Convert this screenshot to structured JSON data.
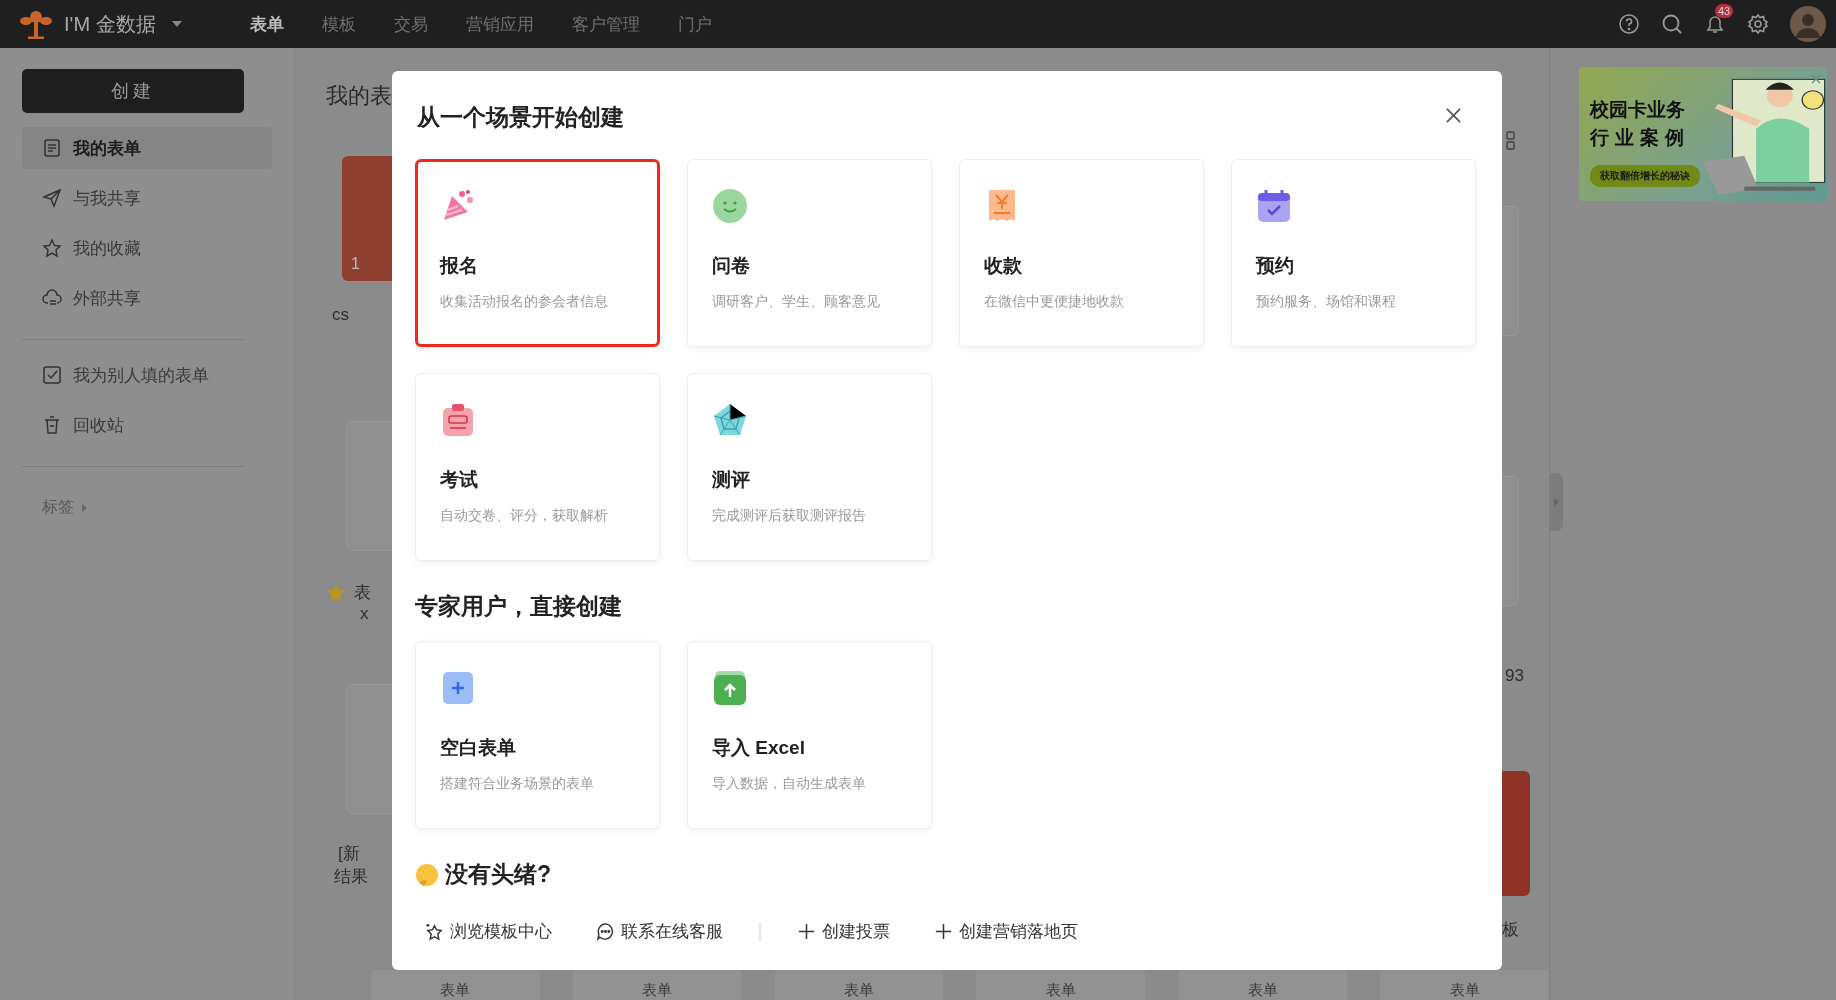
{
  "topbar": {
    "brand": "I'M 金数据",
    "nav": [
      {
        "label": "表单",
        "selected": true
      },
      {
        "label": "模板",
        "selected": false
      },
      {
        "label": "交易",
        "selected": false
      },
      {
        "label": "营销应用",
        "selected": false
      },
      {
        "label": "客户管理",
        "selected": false
      },
      {
        "label": "门户",
        "selected": false
      }
    ],
    "notification_count": "43"
  },
  "sidebar": {
    "create_button": "创建",
    "groups": [
      [
        {
          "kind": "doc",
          "label": "我的表单",
          "selected": true
        },
        {
          "kind": "send",
          "label": "与我共享",
          "selected": false
        },
        {
          "kind": "star",
          "label": "我的收藏",
          "selected": false
        },
        {
          "kind": "cloud",
          "label": "外部共享",
          "selected": false
        }
      ],
      [
        {
          "kind": "check",
          "label": "我为别人填的表单",
          "selected": false
        },
        {
          "kind": "trash",
          "label": "回收站",
          "selected": false
        }
      ]
    ],
    "tags_label": "标签"
  },
  "background": {
    "heading": "我的表",
    "folder_count": "1",
    "left_labels": [
      "cs",
      "表",
      "x",
      "[新",
      "结果"
    ],
    "right_labels": [
      "93",
      "板"
    ],
    "bottom_tabs": [
      "表单",
      "表单",
      "表单",
      "表单",
      "表单",
      "表单"
    ]
  },
  "banner": {
    "title_lines": [
      "校园卡业务",
      "行业案例"
    ],
    "button": "获取翻倍增长的秘诀"
  },
  "modal": {
    "title": "从一个场景开始创建",
    "scenario_cards": [
      {
        "kind": "signup",
        "title": "报名",
        "description": "收集活动报名的参会者信息",
        "selected": true
      },
      {
        "kind": "survey",
        "title": "问卷",
        "description": "调研客户、学生、顾客意见",
        "selected": false
      },
      {
        "kind": "payment",
        "title": "收款",
        "description": "在微信中更便捷地收款",
        "selected": false
      },
      {
        "kind": "booking",
        "title": "预约",
        "description": "预约服务、场馆和课程",
        "selected": false
      },
      {
        "kind": "exam",
        "title": "考试",
        "description": "自动交卷、评分，获取解析",
        "selected": false
      },
      {
        "kind": "assessment",
        "title": "测评",
        "description": "完成测评后获取测评报告",
        "selected": false
      }
    ],
    "expert_title": "专家用户，直接创建",
    "expert_cards": [
      {
        "kind": "blank",
        "title": "空白表单",
        "description": "搭建符合业务场景的表单",
        "selected": false
      },
      {
        "kind": "import",
        "title": "导入 Excel",
        "description": "导入数据，自动生成表单",
        "selected": false
      }
    ],
    "help_title": "没有头绪?",
    "help_links": [
      [
        {
          "kind": "templates",
          "label": "浏览模板中心"
        },
        {
          "kind": "chat",
          "label": "联系在线客服"
        }
      ],
      [
        {
          "kind": "plus",
          "label": "创建投票"
        },
        {
          "kind": "plus",
          "label": "创建营销落地页"
        }
      ]
    ]
  }
}
